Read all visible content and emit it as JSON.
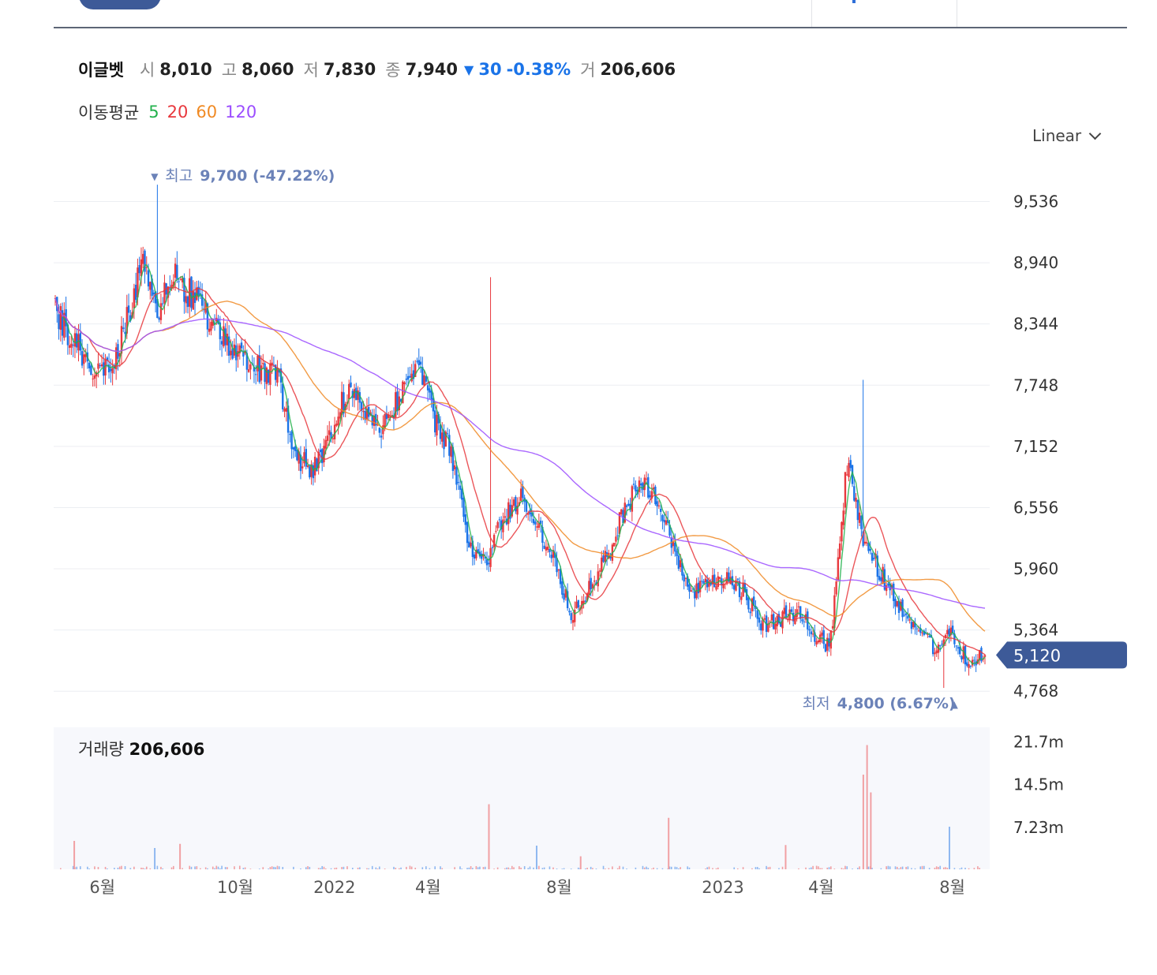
{
  "quote": {
    "name": "이글벳",
    "open_label": "시",
    "open": "8,010",
    "high_label": "고",
    "high": "8,060",
    "low_label": "저",
    "low": "7,830",
    "close_label": "종",
    "close": "7,940",
    "change": "30",
    "change_pct": "-0.38%",
    "volume_label": "거",
    "volume": "206,606"
  },
  "moving_average": {
    "title": "이동평균",
    "periods": [
      {
        "label": "5",
        "color": "#22b14c"
      },
      {
        "label": "20",
        "color": "#e8383d"
      },
      {
        "label": "60",
        "color": "#f08a24"
      },
      {
        "label": "120",
        "color": "#9b4dff"
      }
    ]
  },
  "scale": {
    "selected": "Linear"
  },
  "volume_panel": {
    "title": "거래량",
    "value": "206,606"
  },
  "colors": {
    "up": "#e8383d",
    "down": "#1a73e8",
    "current_tag": "#3d5a98",
    "marker": "#6b82b8"
  },
  "chart_data": [
    {
      "type": "candlestick",
      "title": "",
      "x_ticks": [
        "6월",
        "10월",
        "2022",
        "4월",
        "8월",
        "2023",
        "4월",
        "8월"
      ],
      "y_ticks": [
        "9,536",
        "8,940",
        "8,344",
        "7,748",
        "7,152",
        "6,556",
        "5,960",
        "5,364",
        "4,768"
      ],
      "ylim": [
        4700,
        9900
      ],
      "grid": true,
      "current_price": {
        "value": 5120,
        "label": "5,120"
      },
      "high_marker": {
        "label": "최고",
        "value": "9,700 (-47.22%)",
        "price": 9700
      },
      "low_marker": {
        "label": "최저",
        "value": "4,800 (6.67%)",
        "price": 4800
      },
      "trend_close": [
        8450,
        8200,
        7950,
        7880,
        8250,
        8950,
        8500,
        8800,
        8600,
        8400,
        8150,
        7950,
        7900,
        7800,
        7050,
        6900,
        7300,
        7700,
        7500,
        7350,
        7650,
        8000,
        7400,
        7100,
        6200,
        6000,
        6450,
        6650,
        6400,
        6050,
        5500,
        5800,
        6050,
        6500,
        6850,
        6600,
        6100,
        5700,
        5800,
        5850,
        5750,
        5400,
        5450,
        5550,
        5350,
        5200,
        7000,
        6200,
        5900,
        5600,
        5400,
        5200,
        5350,
        5050,
        5120
      ],
      "ma_periods": [
        5,
        20,
        60,
        120
      ]
    },
    {
      "type": "bar",
      "title": "",
      "y_ticks": [
        "21.7m",
        "14.5m",
        "7.23m"
      ],
      "ylim": [
        0,
        24
      ],
      "spikes_millions": [
        {
          "t": 0.022,
          "v": 4.8,
          "up": true
        },
        {
          "t": 0.108,
          "v": 3.6,
          "up": false
        },
        {
          "t": 0.135,
          "v": 4.3,
          "up": true
        },
        {
          "t": 0.465,
          "v": 11.0,
          "up": true
        },
        {
          "t": 0.516,
          "v": 4.0,
          "up": false
        },
        {
          "t": 0.563,
          "v": 2.2,
          "up": true
        },
        {
          "t": 0.657,
          "v": 8.7,
          "up": true
        },
        {
          "t": 0.782,
          "v": 4.1,
          "up": true
        },
        {
          "t": 0.865,
          "v": 16.0,
          "up": true
        },
        {
          "t": 0.869,
          "v": 21.0,
          "up": true
        },
        {
          "t": 0.873,
          "v": 13.0,
          "up": true
        },
        {
          "t": 0.957,
          "v": 7.2,
          "up": false
        }
      ]
    }
  ]
}
